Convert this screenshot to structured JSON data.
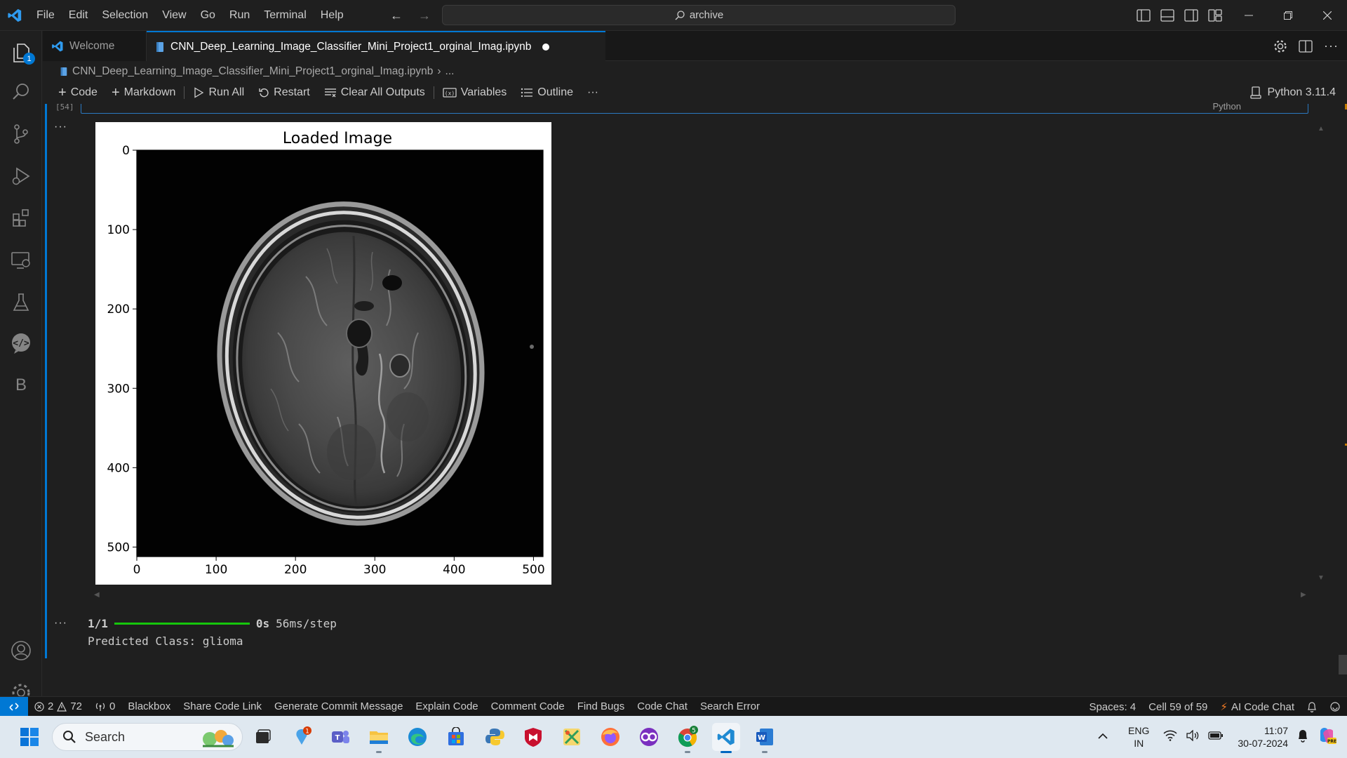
{
  "titlebar": {
    "menu": [
      "File",
      "Edit",
      "Selection",
      "View",
      "Go",
      "Run",
      "Terminal",
      "Help"
    ],
    "search_text": "archive"
  },
  "activity": {
    "explorer_badge": "1",
    "b_label": "B"
  },
  "tabs": {
    "welcome": "Welcome",
    "notebook": "CNN_Deep_Learning_Image_Classifier_Mini_Project1_orginal_Imag.ipynb"
  },
  "breadcrumb": {
    "file": "CNN_Deep_Learning_Image_Classifier_Mini_Project1_orginal_Imag.ipynb",
    "more": "..."
  },
  "toolbar": {
    "code": "Code",
    "markdown": "Markdown",
    "run_all": "Run All",
    "restart": "Restart",
    "clear_outputs": "Clear All Outputs",
    "variables": "Variables",
    "outline": "Outline",
    "more": "···",
    "kernel": "Python 3.11.4"
  },
  "cell": {
    "prev_exec_count": "[54]",
    "prev_language": "Python",
    "output_dots": "···",
    "progress_count": "1/1",
    "progress_time": "0s",
    "progress_rate": "56ms/step",
    "predicted": "Predicted Class: glioma"
  },
  "chart_data": {
    "type": "image",
    "title": "Loaded Image",
    "x_ticks": [
      "0",
      "100",
      "200",
      "300",
      "400",
      "500"
    ],
    "y_ticks": [
      "0",
      "100",
      "200",
      "300",
      "400",
      "500"
    ],
    "xlim": [
      0,
      512
    ],
    "ylim": [
      512,
      0
    ],
    "image_content": "axial brain MRI scan"
  },
  "statusbar": {
    "errors": "2",
    "warnings": "72",
    "ports": "0",
    "items": [
      "Blackbox",
      "Share Code Link",
      "Generate Commit Message",
      "Explain Code",
      "Comment Code",
      "Find Bugs",
      "Code Chat",
      "Search Error"
    ],
    "spaces": "Spaces: 4",
    "cell_pos": "Cell 59 of 59",
    "ai_chat": "AI Code Chat"
  },
  "taskbar": {
    "search_placeholder": "Search",
    "notif_badge": "1",
    "chrome_badge": "5",
    "lang_top": "ENG",
    "lang_bottom": "IN",
    "time": "11:07",
    "date": "30-07-2024"
  },
  "colors": {
    "accent": "#0078d4",
    "progress": "#16c60c",
    "editor_bg": "#1f1f1f"
  }
}
